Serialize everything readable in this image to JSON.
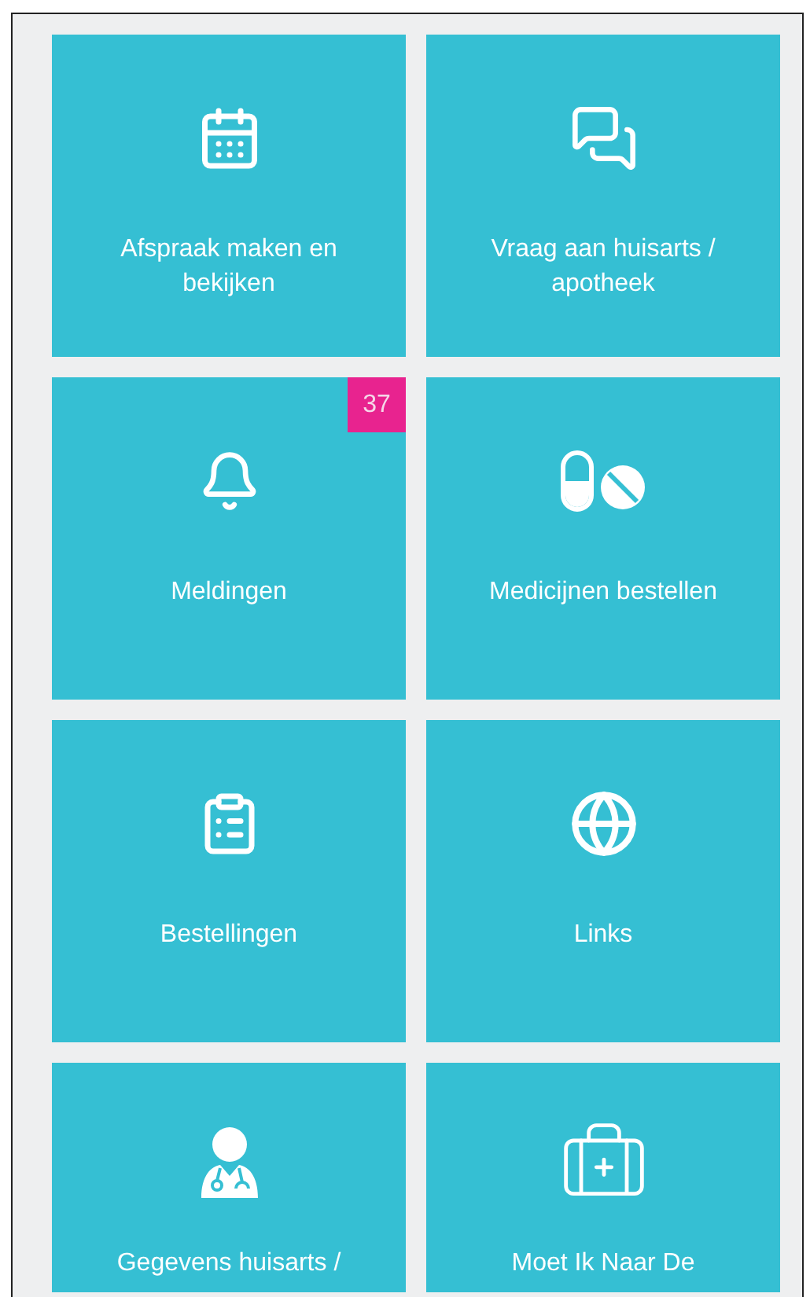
{
  "tiles": [
    {
      "kind": "calendar",
      "label": "Afspraak maken en bekijken"
    },
    {
      "kind": "chat",
      "label": "Vraag aan huisarts / apotheek"
    },
    {
      "kind": "bell",
      "label": "Meldingen",
      "badge": "37"
    },
    {
      "kind": "pills",
      "label": "Medicijnen bestellen"
    },
    {
      "kind": "clipboard",
      "label": "Bestellingen"
    },
    {
      "kind": "globe",
      "label": "Links"
    },
    {
      "kind": "doctor",
      "label": "Gegevens huisarts /"
    },
    {
      "kind": "medkit",
      "label": "Moet Ik Naar De"
    }
  ]
}
